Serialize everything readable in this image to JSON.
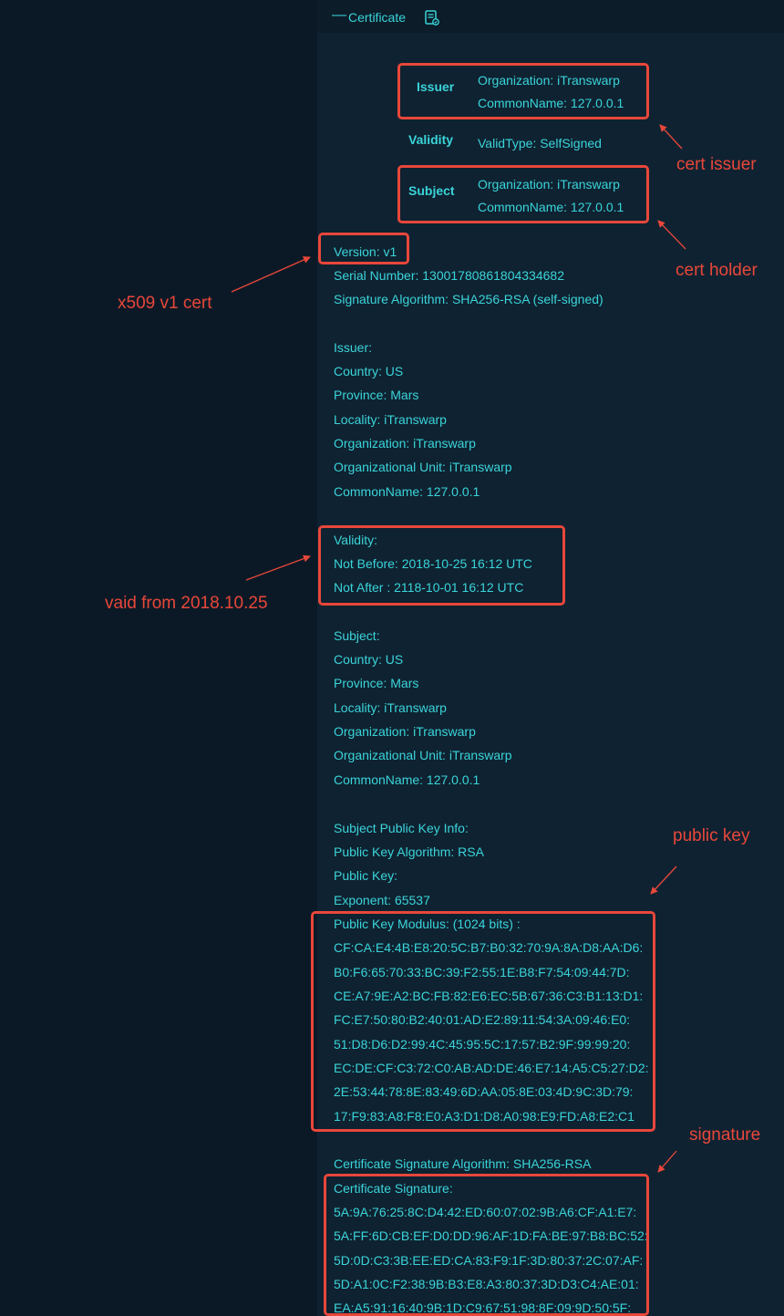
{
  "header": {
    "title": "Certificate",
    "collapse_symbol": "—",
    "icon": "certificate-file-icon"
  },
  "summary": {
    "issuer_label": "Issuer",
    "issuer_lines": [
      "Organization: iTranswarp",
      "CommonName: 127.0.0.1"
    ],
    "validity_label": "Validity",
    "validity_line": "ValidType: SelfSigned",
    "subject_label": "Subject",
    "subject_lines": [
      "Organization: iTranswarp",
      "CommonName: 127.0.0.1"
    ]
  },
  "details": {
    "version": "Version: v1",
    "serial": "Serial Number: 13001780861804334682",
    "sig_algorithm": "Signature Algorithm: SHA256-RSA (self-signed)",
    "issuer": [
      "Issuer:",
      "Country: US",
      "Province: Mars",
      "Locality: iTranswarp",
      "Organization: iTranswarp",
      "Organizational Unit: iTranswarp",
      "CommonName: 127.0.0.1"
    ],
    "validity": [
      "Validity:",
      "Not Before: 2018-10-25 16:12 UTC",
      "Not After : 2118-10-01 16:12 UTC"
    ],
    "subject": [
      "Subject:",
      "Country: US",
      "Province: Mars",
      "Locality: iTranswarp",
      "Organization: iTranswarp",
      "Organizational Unit: iTranswarp",
      "CommonName: 127.0.0.1"
    ],
    "pubkey_info": [
      "Subject Public Key Info:",
      "Public Key Algorithm: RSA",
      "Public Key:",
      "Exponent: 65537"
    ],
    "modulus_title": "Public Key Modulus: (1024 bits) :",
    "modulus": [
      "CF:CA:E4:4B:E8:20:5C:B7:B0:32:70:9A:8A:D8:AA:D6:",
      "B0:F6:65:70:33:BC:39:F2:55:1E:B8:F7:54:09:44:7D:",
      "CE:A7:9E:A2:BC:FB:82:E6:EC:5B:67:36:C3:B1:13:D1:",
      "FC:E7:50:80:B2:40:01:AD:E2:89:11:54:3A:09:46:E0:",
      "51:D8:D6:D2:99:4C:45:95:5C:17:57:B2:9F:99:99:20:",
      "EC:DE:CF:C3:72:C0:AB:AD:DE:46:E7:14:A5:C5:27:D2:",
      "2E:53:44:78:8E:83:49:6D:AA:05:8E:03:4D:9C:3D:79:",
      "17:F9:83:A8:F8:E0:A3:D1:D8:A0:98:E9:FD:A8:E2:C1"
    ],
    "cert_sig_algorithm": "Certificate Signature Algorithm: SHA256-RSA",
    "signature_title": "Certificate Signature:",
    "signature": [
      "5A:9A:76:25:8C:D4:42:ED:60:07:02:9B:A6:CF:A1:E7:",
      "5A:FF:6D:CB:EF:D0:DD:96:AF:1D:FA:BE:97:B8:BC:52:",
      "5D:0D:C3:3B:EE:ED:CA:83:F9:1F:3D:80:37:2C:07:AF:",
      "5D:A1:0C:F2:38:9B:B3:E8:A3:80:37:3D:D3:C4:AE:01:",
      "EA:A5:91:16:40:9B:1D:C9:67:51:98:8F:09:9D:50:5F:"
    ]
  },
  "annotations": {
    "cert_issuer": "cert issuer",
    "cert_holder": "cert holder",
    "x509": "x509 v1 cert",
    "valid_from": "vaid from 2018.10.25",
    "public_key": "public key",
    "signature": "signature"
  },
  "colors": {
    "text": "#3ad4d9",
    "annotation": "#e8473a",
    "panel": "#0f2231",
    "page": "#0b1926"
  }
}
